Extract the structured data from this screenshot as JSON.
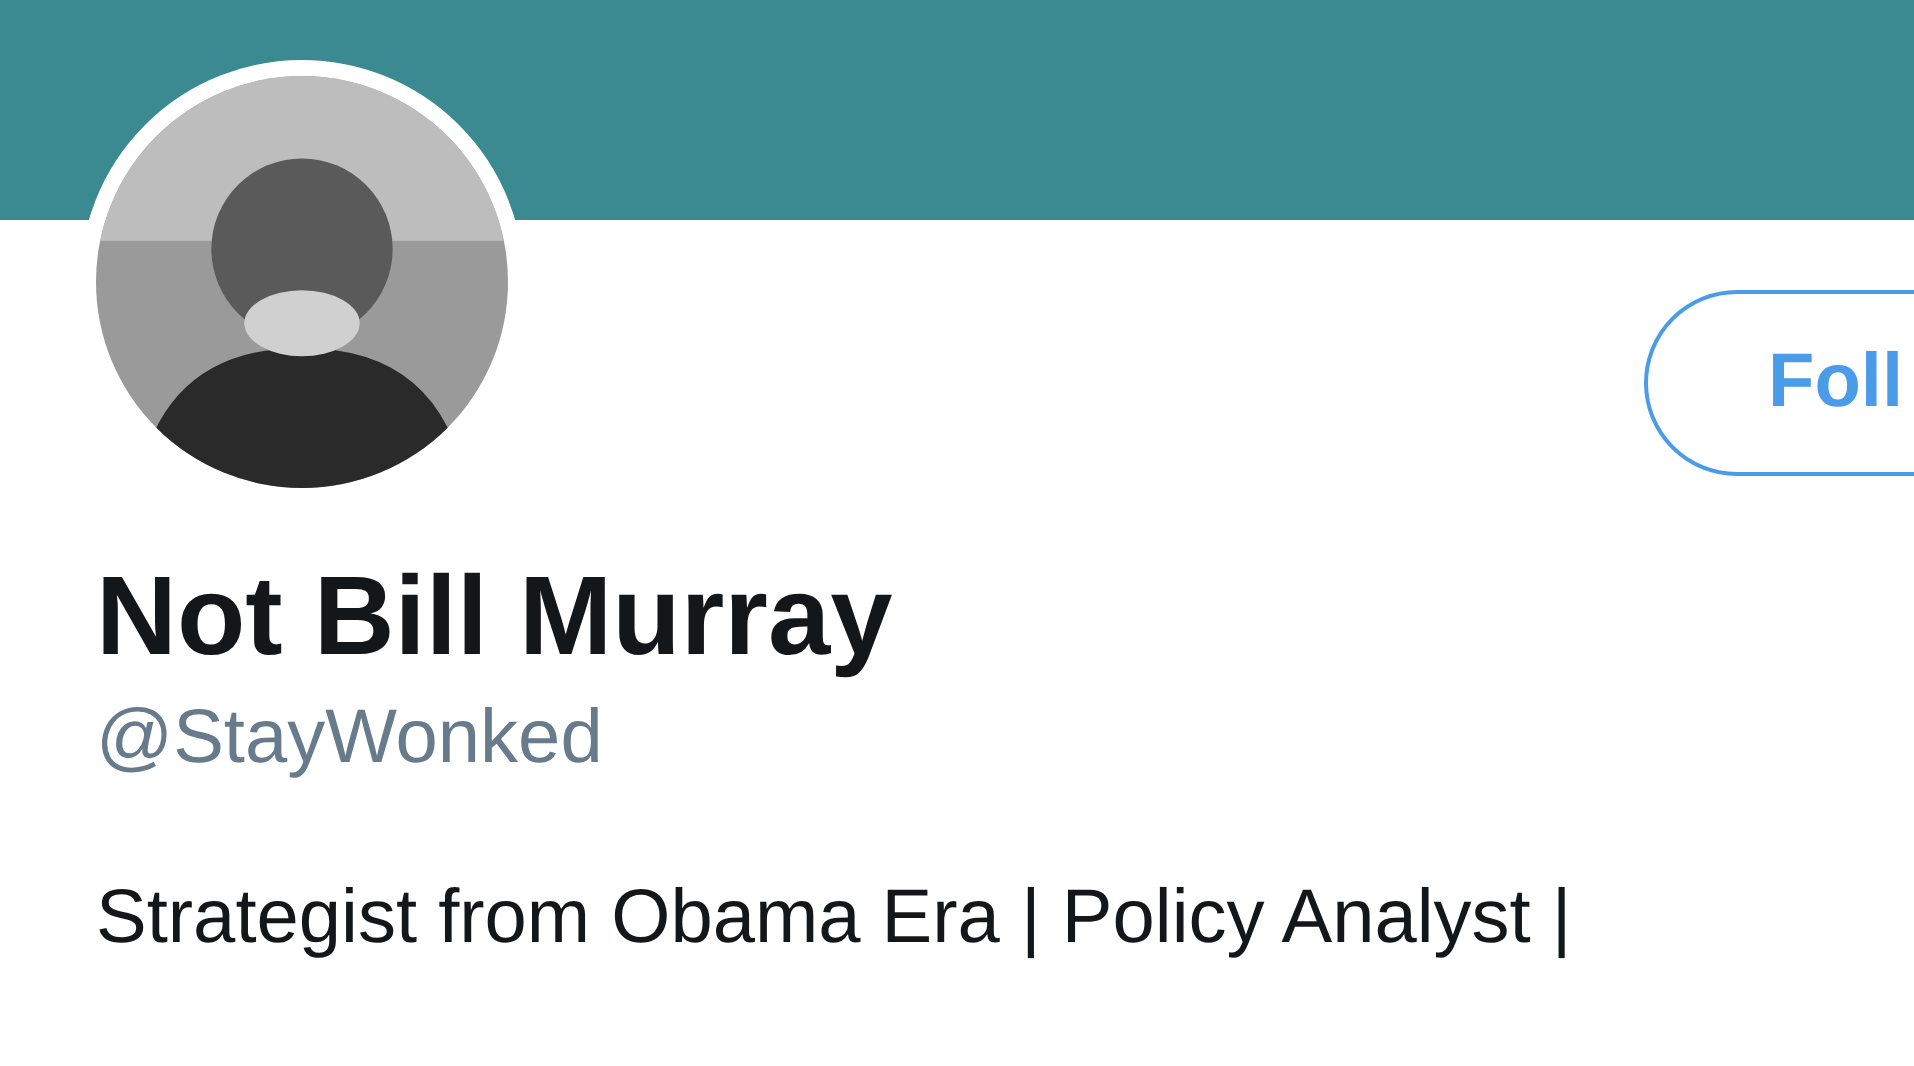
{
  "profile": {
    "follow_button": "Foll",
    "name": "Not Bill Murray",
    "handle": "@StayWonked",
    "bio": "Strategist from Obama Era | Policy Analyst |"
  }
}
